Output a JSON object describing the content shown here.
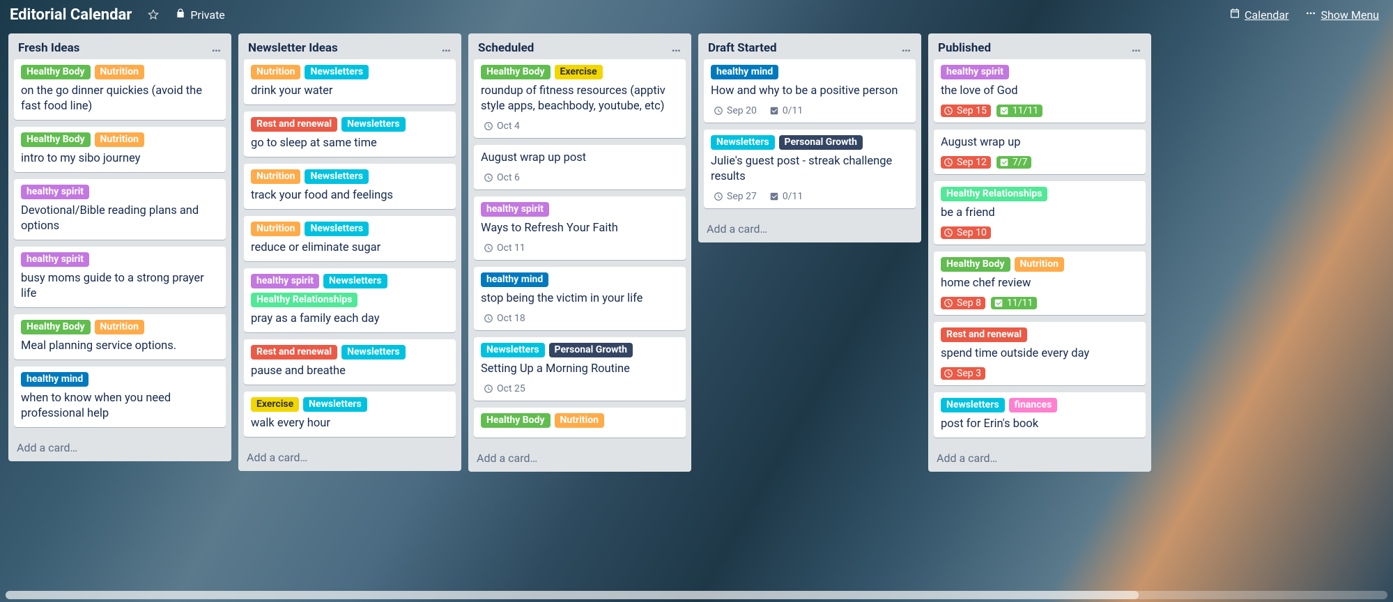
{
  "header": {
    "title": "Editorial Calendar",
    "privacy": "Private",
    "calendar_link": "Calendar",
    "show_menu": "Show Menu"
  },
  "add_card_text": "Add a card…",
  "label_colors": {
    "Healthy Body": "#61bd4f",
    "Nutrition": "#ffab4a",
    "healthy spirit": "#c377e0",
    "healthy mind": "#0079bf",
    "Rest and renewal": "#eb5a46",
    "Newsletters": "#00c2e0",
    "Healthy Relationships": "#51e898",
    "Exercise": "#f2d600",
    "Personal Growth": "#344563",
    "finances": "#ff80ce"
  },
  "lists": [
    {
      "name": "Fresh Ideas",
      "cards": [
        {
          "labels": [
            "Healthy Body",
            "Nutrition"
          ],
          "title": "on the go dinner quickies (avoid the fast food line)"
        },
        {
          "labels": [
            "Healthy Body",
            "Nutrition"
          ],
          "title": "intro to my sibo journey"
        },
        {
          "labels": [
            "healthy spirit"
          ],
          "title": "Devotional/Bible reading plans and options"
        },
        {
          "labels": [
            "healthy spirit"
          ],
          "title": "busy moms guide to a strong prayer life"
        },
        {
          "labels": [
            "Healthy Body",
            "Nutrition"
          ],
          "title": "Meal planning service options."
        },
        {
          "labels": [
            "healthy mind"
          ],
          "title": "when to know when you need professional help"
        }
      ]
    },
    {
      "name": "Newsletter Ideas",
      "cards": [
        {
          "labels": [
            "Nutrition",
            "Newsletters"
          ],
          "title": "drink your water"
        },
        {
          "labels": [
            "Rest and renewal",
            "Newsletters"
          ],
          "title": "go to sleep at same time"
        },
        {
          "labels": [
            "Nutrition",
            "Newsletters"
          ],
          "title": "track your food and feelings"
        },
        {
          "labels": [
            "Nutrition",
            "Newsletters"
          ],
          "title": "reduce or eliminate sugar"
        },
        {
          "labels": [
            "healthy spirit",
            "Newsletters",
            "Healthy Relationships"
          ],
          "title": "pray as a family each day"
        },
        {
          "labels": [
            "Rest and renewal",
            "Newsletters"
          ],
          "title": "pause and breathe"
        },
        {
          "labels": [
            "Exercise",
            "Newsletters"
          ],
          "title": "walk every hour"
        }
      ]
    },
    {
      "name": "Scheduled",
      "cards": [
        {
          "labels": [
            "Healthy Body",
            "Exercise"
          ],
          "title": "roundup of fitness resources (apptiv style apps, beachbody, youtube, etc)",
          "due": "Oct 4"
        },
        {
          "labels": [],
          "title": "August wrap up post",
          "due": "Oct 6"
        },
        {
          "labels": [
            "healthy spirit"
          ],
          "title": "Ways to Refresh Your Faith",
          "due": "Oct 11"
        },
        {
          "labels": [
            "healthy mind"
          ],
          "title": "stop being the victim in your life",
          "due": "Oct 18"
        },
        {
          "labels": [
            "Newsletters",
            "Personal Growth"
          ],
          "title": "Setting Up a Morning Routine",
          "due": "Oct 25"
        },
        {
          "labels": [
            "Healthy Body",
            "Nutrition"
          ],
          "title": ""
        }
      ]
    },
    {
      "name": "Draft Started",
      "cards": [
        {
          "labels": [
            "healthy mind"
          ],
          "title": "How and why to be a positive person",
          "due": "Sep 20",
          "checklist": "0/11"
        },
        {
          "labels": [
            "Newsletters",
            "Personal Growth"
          ],
          "title": "Julie's guest post - streak challenge results",
          "due": "Sep 27",
          "checklist": "0/11"
        }
      ]
    },
    {
      "name": "Published",
      "cards": [
        {
          "labels": [
            "healthy spirit"
          ],
          "title": "the love of God",
          "due": "Sep 15",
          "due_color": "red",
          "checklist": "11/11",
          "checklist_color": "green"
        },
        {
          "labels": [],
          "title": "August wrap up",
          "due": "Sep 12",
          "due_color": "red",
          "checklist": "7/7",
          "checklist_color": "green"
        },
        {
          "labels": [
            "Healthy Relationships"
          ],
          "title": "be a friend",
          "due": "Sep 10",
          "due_color": "red"
        },
        {
          "labels": [
            "Healthy Body",
            "Nutrition"
          ],
          "title": "home chef review",
          "due": "Sep 8",
          "due_color": "red",
          "checklist": "11/11",
          "checklist_color": "green"
        },
        {
          "labels": [
            "Rest and renewal"
          ],
          "title": "spend time outside every day",
          "due": "Sep 3",
          "due_color": "red"
        },
        {
          "labels": [
            "Newsletters",
            "finances"
          ],
          "title": "post for Erin's book"
        }
      ]
    }
  ]
}
